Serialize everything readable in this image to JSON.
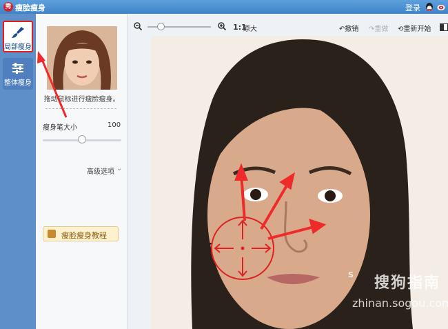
{
  "app": {
    "logo_text": "秀",
    "title": "瘦脸瘦身",
    "login": "登录"
  },
  "tabs": [
    {
      "label": "局部瘦身",
      "icon": "brush-icon",
      "active": true
    },
    {
      "label": "整体瘦身",
      "icon": "sliders-icon",
      "active": false
    }
  ],
  "panel": {
    "hint": "拖动鼠标进行瘦脸瘦身。",
    "brush_label": "瘦身笔大小",
    "brush_value": "100",
    "brush_level": 0.5,
    "advanced": "高级选项",
    "tutorial": "瘦脸瘦身教程"
  },
  "toolbar": {
    "ratio": "1:1",
    "original": "原大",
    "undo": "撤销",
    "redo": "重做",
    "restart": "重新开始"
  },
  "watermark": {
    "logo": "S",
    "cn": "搜狗指南",
    "url": "zhinan.sogou.com"
  },
  "colors": {
    "accent": "#e02020",
    "titlebar": "#3d83c7",
    "sidebar": "#5f8fc9"
  }
}
